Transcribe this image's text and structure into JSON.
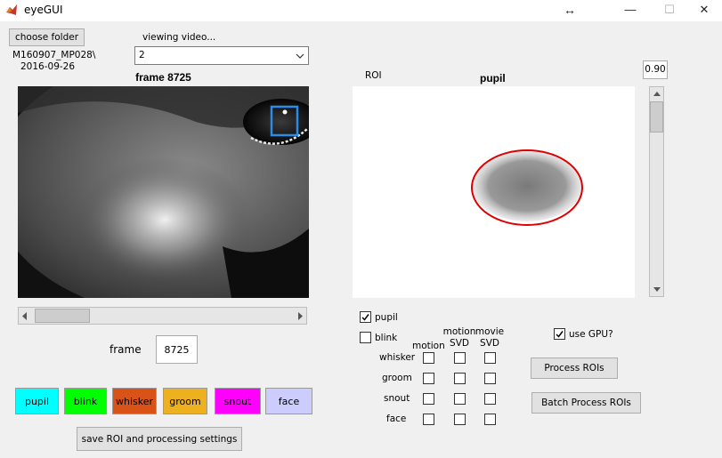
{
  "window": {
    "title": "eyeGUI",
    "minimize": "—",
    "maximize": "☐",
    "close": "✕",
    "resize_glyph": "↔"
  },
  "folder": {
    "button_label": "choose folder",
    "path_line1": "M160907_MP028\\",
    "path_line2": "2016-09-26"
  },
  "video": {
    "label": "viewing video...",
    "selected": "2"
  },
  "frame_view": {
    "title": "frame 8725"
  },
  "slider": {
    "position_fraction": 0.0
  },
  "frame_input": {
    "label": "frame",
    "value": "8725"
  },
  "roi_buttons": [
    {
      "label": "pupil",
      "color": "#00ffff"
    },
    {
      "label": "blink",
      "color": "#00ff00"
    },
    {
      "label": "whisker",
      "color": "#d95319"
    },
    {
      "label": "groom",
      "color": "#edb120"
    },
    {
      "label": "snout",
      "color": "#ff00ff"
    },
    {
      "label": "face",
      "color": "#ccccff"
    }
  ],
  "save_button": {
    "label": "save ROI and processing settings"
  },
  "roi_view": {
    "label": "ROI",
    "title": "pupil",
    "threshold": "0.90"
  },
  "checks": {
    "pupil": {
      "label": "pupil",
      "checked": true
    },
    "blink": {
      "label": "blink",
      "checked": false
    }
  },
  "grid": {
    "col_headers": [
      "motion",
      "motion\nSVD",
      "movie\nSVD"
    ],
    "rows": [
      "whisker",
      "groom",
      "snout",
      "face"
    ]
  },
  "gpu": {
    "label": "use GPU?",
    "checked": true
  },
  "process_button": {
    "label": "Process ROIs"
  },
  "batch_button": {
    "label": "Batch Process ROIs"
  },
  "colors": {
    "roi_box": "#2d8ae6",
    "pupil_fit": "#e00000"
  }
}
